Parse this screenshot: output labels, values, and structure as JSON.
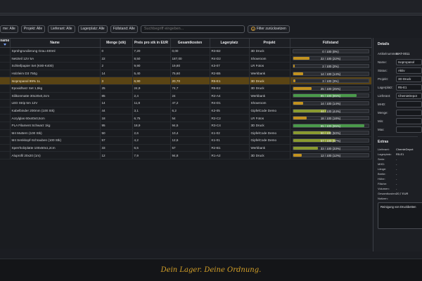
{
  "filters": {
    "kategorie": "me: Alle",
    "projekt": "Projekt: Alle",
    "lieferant": "Lieferant: Alle",
    "lagerplatz": "Lagerplatz: Alle",
    "fuellstand": "Füllstand: Alle",
    "search_placeholder": "Suchbegriff eingeben...",
    "reset_label": "Filter zurücksetzen"
  },
  "table": {
    "columns": [
      "name",
      "Name",
      "Menge (stk)",
      "Preis pro stk in EUR",
      "Gesamtkosten",
      "Lagerplatz",
      "Projekt",
      "Füllstand"
    ],
    "rows": [
      {
        "c0": "",
        "name": "Sprühgrundierung Grau 400ml",
        "menge": "0",
        "preis": "7,20",
        "gesamt": "0,00",
        "lager": "R3-B2",
        "projekt": "3D Druck",
        "fill_text": "0 / 100 (0%)",
        "fill": 0,
        "color": "#3a3d42"
      },
      {
        "c0": "",
        "name": "Netzteil 12V 5A",
        "menge": "22",
        "preis": "8,50",
        "gesamt": "187,00",
        "lager": "R4-D2",
        "projekt": "Showroom",
        "fill_text": "22 / 100 (22%)",
        "fill": 0.22,
        "color": "#c2921f"
      },
      {
        "c0": "",
        "name": "Schleifpapier Set (K80-K400)",
        "menge": "2",
        "preis": "9,90",
        "gesamt": "19,80",
        "lager": "K3-07",
        "projekt": "LR Fotos",
        "fill_text": "2 / 100 (2%)",
        "fill": 0.02,
        "color": "#c2921f"
      },
      {
        "c0": "",
        "name": "Holzleim D3 750g",
        "menge": "14",
        "preis": "5,40",
        "gesamt": "75,60",
        "lager": "R2-B5",
        "projekt": "Werkbank",
        "fill_text": "14 / 100 (14%)",
        "fill": 0.14,
        "color": "#c2921f"
      },
      {
        "c0": "",
        "name": "Isopropanol 99% 1L",
        "menge": "3",
        "preis": "6,90",
        "gesamt": "20,70",
        "lager": "R5-E1",
        "projekt": "3D Druck",
        "fill_text": "3 / 100 (3%)",
        "fill": 0.03,
        "color": "#c2921f",
        "selected": true
      },
      {
        "c0": "",
        "name": "Epoxidharz Set 1,5kg",
        "menge": "25",
        "preis": "24,9",
        "gesamt": "74,7",
        "lager": "R5-E2",
        "projekt": "3D Druck",
        "fill_text": "25 / 100 (25%)",
        "fill": 0.25,
        "color": "#c2921f"
      },
      {
        "c0": "",
        "name": "Silikonmatte 30x20x0,2cm",
        "menge": "85",
        "preis": "2,4",
        "gesamt": "24",
        "lager": "R2-A4",
        "projekt": "Werkbank",
        "fill_text": "85 / 100 (85%)",
        "fill": 0.85,
        "color": "#4a9a4a"
      },
      {
        "c0": "",
        "name": "LED Strip 5m 12V",
        "menge": "14",
        "preis": "11,8",
        "gesamt": "47,2",
        "lager": "R4-D1",
        "projekt": "Showroom",
        "fill_text": "14 / 100 (14%)",
        "fill": 0.14,
        "color": "#c2921f"
      },
      {
        "c0": "",
        "name": "Kabelbinder 200mm (100 Stk)",
        "menge": "44",
        "preis": "3,1",
        "gesamt": "6,2",
        "lager": "K2-05",
        "projekt": "GipfelCode Demo",
        "fill_text": "44 / 100 (44%)",
        "fill": 0.44,
        "color": "#8a9a30"
      },
      {
        "c0": "",
        "name": "Acrylglas 60x40x0,5cm",
        "menge": "18",
        "preis": "6,75",
        "gesamt": "54",
        "lager": "R2-C2",
        "projekt": "LR Fotos",
        "fill_text": "18 / 100 (18%)",
        "fill": 0.18,
        "color": "#c2921f"
      },
      {
        "c0": "",
        "name": "PLA Filament Schwarz 1kg",
        "menge": "95",
        "preis": "18,9",
        "gesamt": "94,5",
        "lager": "R3-C4",
        "projekt": "3D Druck",
        "fill_text": "95 / 100 (95%)",
        "fill": 0.95,
        "color": "#4a9a4a"
      },
      {
        "c0": "",
        "name": "M4 Muttern (100 Stk)",
        "menge": "50",
        "preis": "2,6",
        "gesamt": "10,4",
        "lager": "K1-02",
        "projekt": "GipfelCode Demo",
        "fill_text": "50 / 100 (50%)",
        "fill": 0.5,
        "color": "#8a9a30"
      },
      {
        "c0": "",
        "name": "M4 Senkkopf-Schrauben (100 Stk)",
        "menge": "57",
        "preis": "4,2",
        "gesamt": "12,6",
        "lager": "K1-01",
        "projekt": "GipfelCode Demo",
        "fill_text": "57 / 100 (57%)",
        "fill": 0.57,
        "color": "#8a9a30"
      },
      {
        "c0": "",
        "name": "Sperrholzplatte 100x50x1,2cm",
        "menge": "33",
        "preis": "6,5",
        "gesamt": "57",
        "lager": "R2-B1",
        "projekt": "Werkbank",
        "fill_text": "33 / 100 (33%)",
        "fill": 0.33,
        "color": "#8a9a30"
      },
      {
        "c0": "",
        "name": "Aluprofil 20x20 (1m)",
        "menge": "12",
        "preis": "7,9",
        "gesamt": "94,8",
        "lager": "R1-A2",
        "projekt": "3D Druck",
        "fill_text": "12 / 100 (12%)",
        "fill": 0.12,
        "color": "#c2921f"
      }
    ]
  },
  "details": {
    "title": "Details",
    "artikelnummer_label": "Artikelnummer:",
    "artikelnummer": "MAT-0011",
    "name_label": "Name:",
    "name": "Isopropanol",
    "status_label": "Status:",
    "status": "Aktiv",
    "projekt_label": "Projekt:",
    "projekt": "3D Druck",
    "lagerplatz_label": "Lagerplatz:",
    "lagerplatz": "R5-E1",
    "lieferant_label": "Lieferant:",
    "lieferant": "ChemieDepot",
    "mhd_label": "MHD:",
    "menge_label": "Menge:",
    "min_label": "Min:",
    "max_label": "Max:",
    "extras_title": "Extras",
    "extras": [
      {
        "label": "Lieferant:",
        "value": "ChemieDepot"
      },
      {
        "label": "Lagerplatz:",
        "value": "R5-E1"
      },
      {
        "label": "Serie:",
        "value": "-"
      },
      {
        "label": "MHD:",
        "value": "-"
      },
      {
        "label": "Länge:",
        "value": "-"
      },
      {
        "label": "Breite:",
        "value": "-"
      },
      {
        "label": "Höhe:",
        "value": "-"
      },
      {
        "label": "Fläche:",
        "value": "-"
      },
      {
        "label": "Volumen:",
        "value": "-"
      },
      {
        "label": "Gesamtkosten:",
        "value": "20,7 EUR"
      }
    ],
    "notizen_label": "Notizen:",
    "notizen": "Reinigung von Druckbetten"
  },
  "footer": {
    "slogan": "Dein Lager. Deine Ordnung."
  }
}
